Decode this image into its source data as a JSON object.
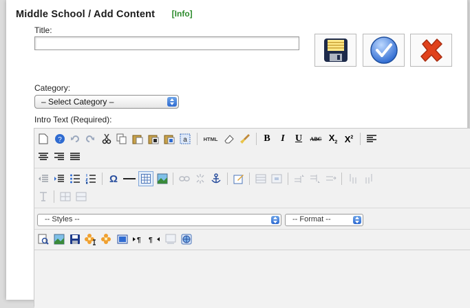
{
  "header": {
    "title": "Middle School / Add  Content",
    "info_link": "[Info]"
  },
  "form": {
    "title_label": "Title:",
    "title_value": "",
    "category_label": "Category:",
    "category_selected": "– Select Category –",
    "intro_label": "Intro Text (Required):"
  },
  "buttons": {
    "save": "save-icon",
    "apply": "check-icon",
    "cancel": "cross-icon"
  },
  "editor": {
    "toolbar_text": {
      "html": "HTML",
      "bold": "B",
      "italic": "I",
      "underline": "U",
      "strike": "ABC",
      "subscript": "X",
      "sub_mark": "2",
      "superscript": "X",
      "sup_mark": "2",
      "omega": "Ω"
    },
    "styles_selected": "-- Styles --",
    "format_selected": "-- Format --"
  },
  "colors": {
    "info": "#2b8a2b",
    "accent_blue": "#2f6bd1",
    "cancel_red": "#e0421c"
  }
}
